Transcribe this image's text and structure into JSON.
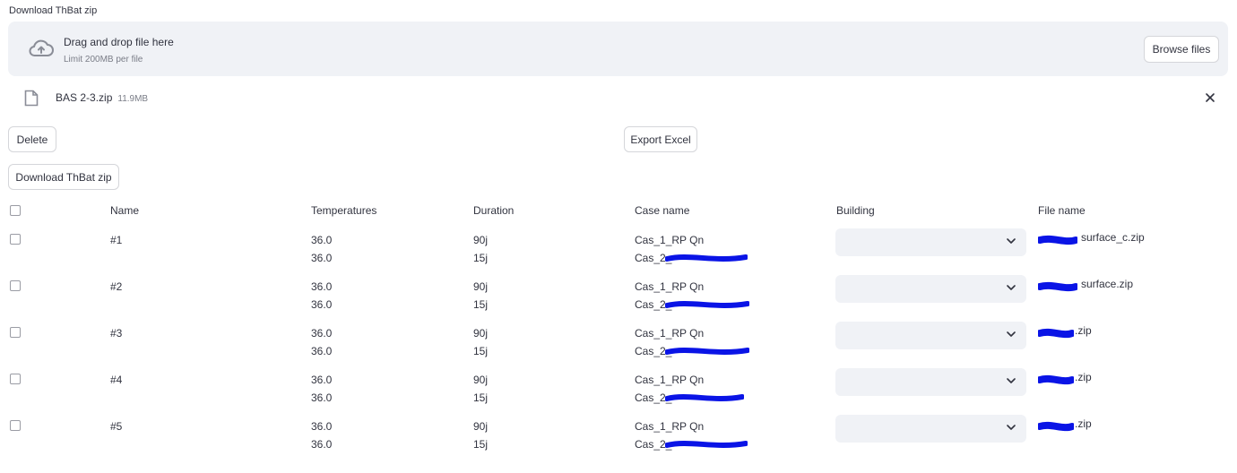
{
  "uploader": {
    "label": "Download ThBat zip",
    "drop_title": "Drag and drop file here",
    "drop_limit": "Limit 200MB per file",
    "browse_label": "Browse files",
    "icon": "cloud-upload-icon"
  },
  "uploaded_file": {
    "name": "BAS 2-3.zip",
    "size": "11.9MB",
    "icon": "file-icon",
    "close_icon": "close-icon"
  },
  "actions": {
    "delete_label": "Delete",
    "export_label": "Export Excel",
    "download_label": "Download ThBat zip"
  },
  "table": {
    "headers": [
      "Name",
      "Temperatures",
      "Duration",
      "Case name",
      "Building",
      "File name"
    ],
    "rows": [
      {
        "name": "#1",
        "temp1": "36.0",
        "temp2": "36.0",
        "dur1": "90j",
        "dur2": "15j",
        "case1": "Cas_1_RP Qn",
        "case2": "Cas_2_",
        "file": "surface_c.zip"
      },
      {
        "name": "#2",
        "temp1": "36.0",
        "temp2": "36.0",
        "dur1": "90j",
        "dur2": "15j",
        "case1": "Cas_1_RP Qn",
        "case2": "Cas_2_",
        "file": "surface.zip"
      },
      {
        "name": "#3",
        "temp1": "36.0",
        "temp2": "36.0",
        "dur1": "90j",
        "dur2": "15j",
        "case1": "Cas_1_RP Qn",
        "case2": "Cas_2_",
        "file": ".zip"
      },
      {
        "name": "#4",
        "temp1": "36.0",
        "temp2": "36.0",
        "dur1": "90j",
        "dur2": "15j",
        "case1": "Cas_1_RP Qn",
        "case2": "Cas_2_",
        "file": ".zip"
      },
      {
        "name": "#5",
        "temp1": "36.0",
        "temp2": "36.0",
        "dur1": "90j",
        "dur2": "15j",
        "case1": "Cas_1_RP Qn",
        "case2": "Cas_2_",
        "file": ".zip"
      }
    ]
  },
  "colors": {
    "redaction": "#0a14e6",
    "dropzone_bg": "#f0f2f6",
    "text": "#31333f"
  }
}
